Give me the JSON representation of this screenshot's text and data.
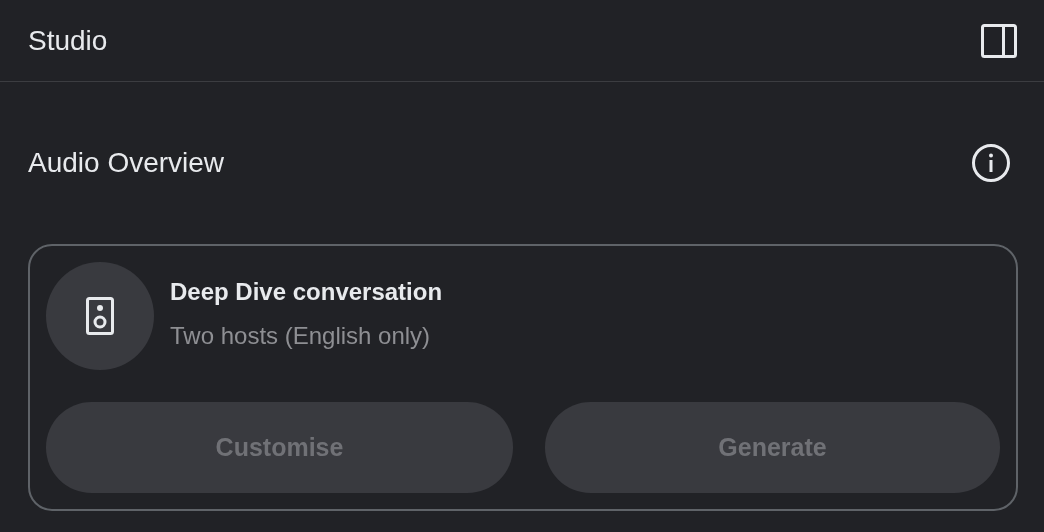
{
  "header": {
    "title": "Studio"
  },
  "section": {
    "title": "Audio Overview"
  },
  "card": {
    "title": "Deep Dive conversation",
    "subtitle": "Two hosts (English only)",
    "buttons": [
      {
        "label": "Customise",
        "disabled": true
      },
      {
        "label": "Generate",
        "disabled": true
      }
    ]
  }
}
